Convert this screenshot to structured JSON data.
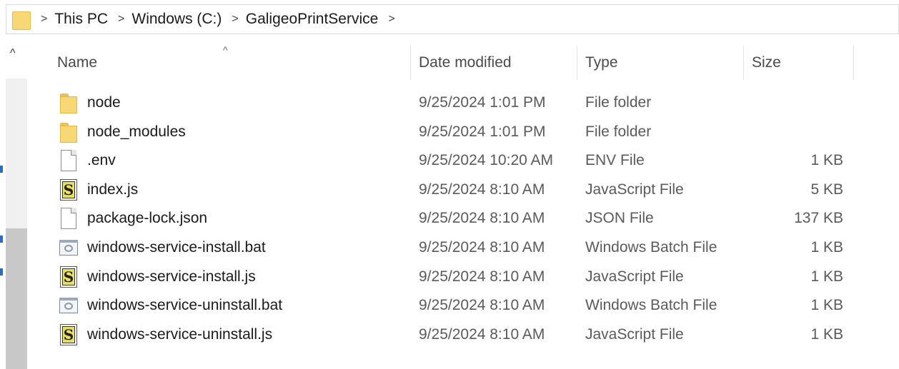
{
  "breadcrumb": {
    "folder_icon": "folder-icon",
    "separator": ">",
    "items": [
      "This PC",
      "Windows (C:)",
      "GaligeoPrintService"
    ],
    "trailing": ">"
  },
  "nav": {
    "up_glyph": "^"
  },
  "columns": {
    "name": "Name",
    "date": "Date modified",
    "type": "Type",
    "size": "Size",
    "sort_glyph": "^"
  },
  "files": [
    {
      "name": "node",
      "date": "9/25/2024 1:01 PM",
      "type": "File folder",
      "size": "",
      "icon": "folder-icon"
    },
    {
      "name": "node_modules",
      "date": "9/25/2024 1:01 PM",
      "type": "File folder",
      "size": "",
      "icon": "folder-icon"
    },
    {
      "name": ".env",
      "date": "9/25/2024 10:20 AM",
      "type": "ENV File",
      "size": "1 KB",
      "icon": "blank-file-icon"
    },
    {
      "name": "index.js",
      "date": "9/25/2024 8:10 AM",
      "type": "JavaScript File",
      "size": "5 KB",
      "icon": "javascript-file-icon"
    },
    {
      "name": "package-lock.json",
      "date": "9/25/2024 8:10 AM",
      "type": "JSON File",
      "size": "137 KB",
      "icon": "blank-file-icon"
    },
    {
      "name": "windows-service-install.bat",
      "date": "9/25/2024 8:10 AM",
      "type": "Windows Batch File",
      "size": "1 KB",
      "icon": "batch-file-icon"
    },
    {
      "name": "windows-service-install.js",
      "date": "9/25/2024 8:10 AM",
      "type": "JavaScript File",
      "size": "1 KB",
      "icon": "javascript-file-icon"
    },
    {
      "name": "windows-service-uninstall.bat",
      "date": "9/25/2024 8:10 AM",
      "type": "Windows Batch File",
      "size": "1 KB",
      "icon": "batch-file-icon"
    },
    {
      "name": "windows-service-uninstall.js",
      "date": "9/25/2024 8:10 AM",
      "type": "JavaScript File",
      "size": "1 KB",
      "icon": "javascript-file-icon"
    }
  ],
  "colors": {
    "folder": "#f8d775",
    "text": "#1a1a1a",
    "muted_text": "#5a5a5a",
    "js_badge": "#e9df62"
  }
}
